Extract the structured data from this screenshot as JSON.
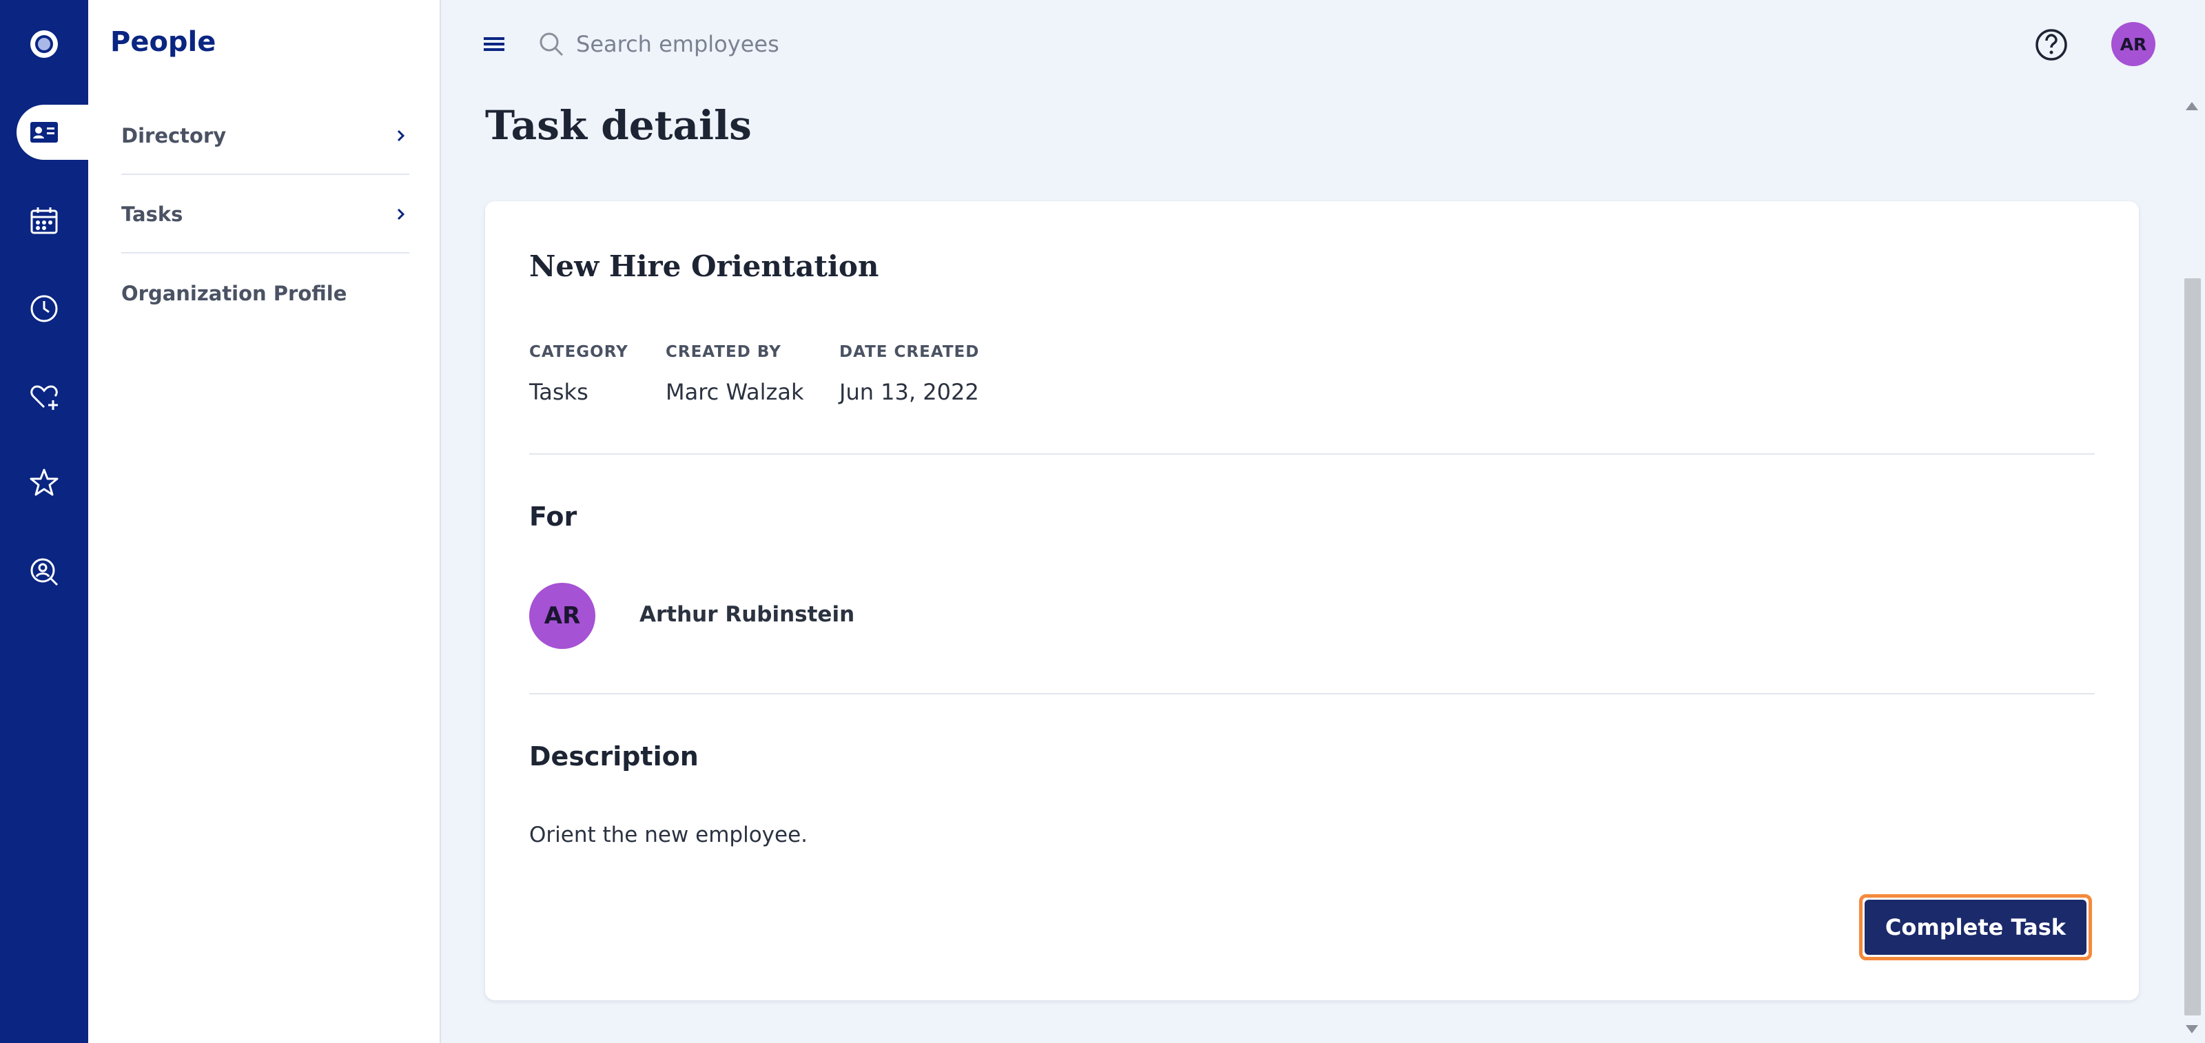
{
  "sidebar": {
    "title": "People",
    "items": [
      {
        "label": "Directory"
      },
      {
        "label": "Tasks"
      },
      {
        "label": "Organization Profile"
      }
    ]
  },
  "rail": {
    "icons": [
      "logo-icon",
      "people-card-icon",
      "calendar-icon",
      "clock-icon",
      "heart-plus-icon",
      "star-icon",
      "person-search-icon"
    ],
    "active": "people-card-icon"
  },
  "header": {
    "search_placeholder": "Search employees",
    "avatar_initials": "AR"
  },
  "page": {
    "title": "Task details"
  },
  "task": {
    "title": "New Hire Orientation",
    "meta": [
      {
        "label": "CATEGORY",
        "value": "Tasks"
      },
      {
        "label": "CREATED BY",
        "value": "Marc Walzak"
      },
      {
        "label": "DATE CREATED",
        "value": "Jun 13, 2022"
      }
    ],
    "for_heading": "For",
    "assignee": {
      "initials": "AR",
      "name": "Arthur Rubinstein"
    },
    "description_heading": "Description",
    "description": "Orient the new employee.",
    "complete_label": "Complete Task"
  },
  "colors": {
    "rail": "#0a2582",
    "accent_avatar": "#a652d4",
    "button": "#1b2a6b",
    "button_focus": "#f4893c"
  }
}
